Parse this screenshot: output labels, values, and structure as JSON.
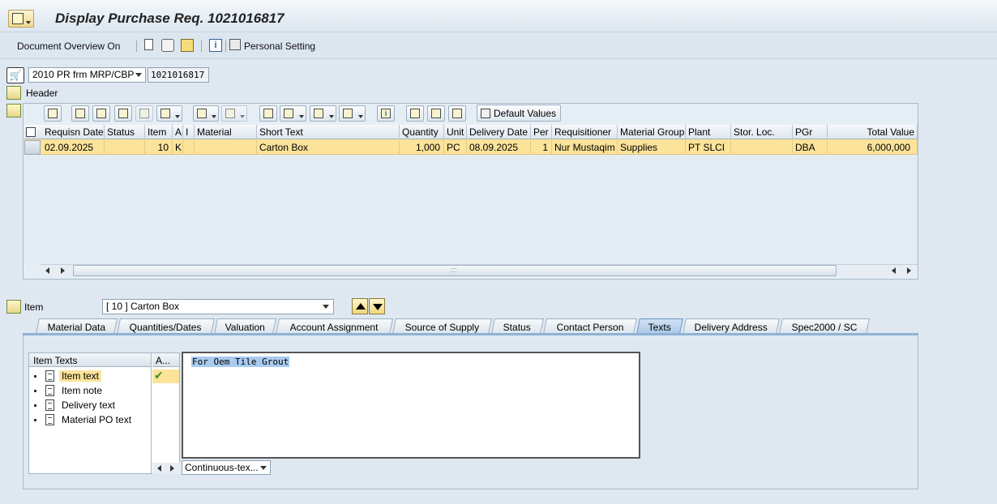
{
  "window": {
    "title": "Display Purchase Req. 1021016817"
  },
  "toolbar": {
    "document_overview": "Document Overview On",
    "personal_setting": "Personal Setting",
    "info_glyph": "i"
  },
  "doc": {
    "type_value": "2010 PR frm MRP/CBP",
    "number": "1021016817"
  },
  "sections": {
    "header": "Header",
    "item": "Item"
  },
  "grid_toolbar": {
    "default_values": "Default Values",
    "info_glyph": "i"
  },
  "table": {
    "columns": [
      "Requisn Date",
      "Status",
      "Item",
      "A",
      "I",
      "Material",
      "Short Text",
      "Quantity",
      "Unit",
      "Delivery Date",
      "Per",
      "Requisitioner",
      "Material Group",
      "Plant",
      "Stor. Loc.",
      "PGr",
      "Total Value"
    ],
    "rows": [
      [
        "02.09.2025",
        "",
        "10",
        "K",
        "",
        "",
        "Carton Box",
        "1,000",
        "PC",
        "08.09.2025",
        "1",
        "Nur Mustaqim",
        "Supplies",
        "PT SLCI",
        "",
        "DBA",
        "6,000,000"
      ]
    ],
    "scroll_grip": ":::"
  },
  "item_select": {
    "value": "[ 10 ] Carton Box"
  },
  "tabs": [
    {
      "label": "Material Data"
    },
    {
      "label": "Quantities/Dates"
    },
    {
      "label": "Valuation"
    },
    {
      "label": "Account Assignment"
    },
    {
      "label": "Source of Supply"
    },
    {
      "label": "Status"
    },
    {
      "label": "Contact Person"
    },
    {
      "label": "Texts",
      "active": true
    },
    {
      "label": "Delivery Address"
    },
    {
      "label": "Spec2000 / SC"
    }
  ],
  "texts": {
    "tree_header": "Item Texts",
    "a_header": "A...",
    "items": [
      "Item text",
      "Item note",
      "Delivery text",
      "Material PO text"
    ],
    "check_glyph": "✔",
    "editor_content": "For Oem Tile Grout",
    "format_value": "Continuous-tex..."
  },
  "colors": {
    "selected_row": "#fbe39a",
    "active_tab": "#a9c7e6",
    "background": "#dfe8f1"
  }
}
